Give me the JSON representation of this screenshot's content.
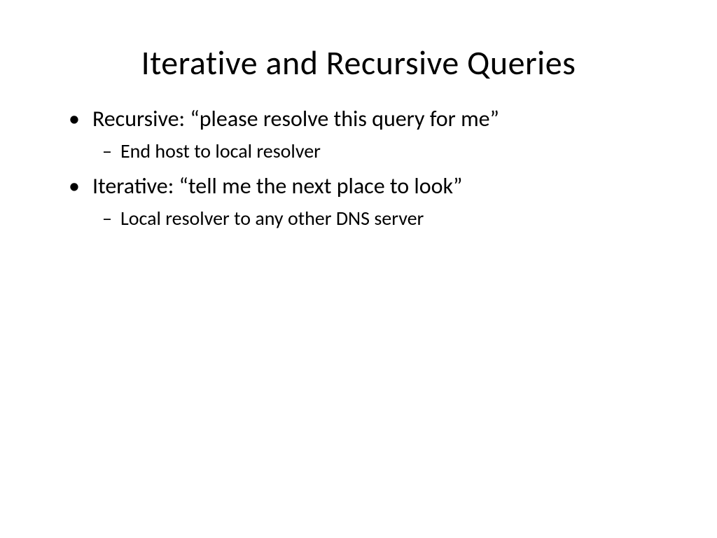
{
  "slide": {
    "title": "Iterative and Recursive Queries",
    "bullets": [
      {
        "text": "Recursive: “please resolve this query for me”",
        "sub": [
          "End host to local resolver"
        ]
      },
      {
        "text": "Iterative: “tell me the next place to look”",
        "sub": [
          "Local resolver to any other DNS server"
        ]
      }
    ]
  }
}
